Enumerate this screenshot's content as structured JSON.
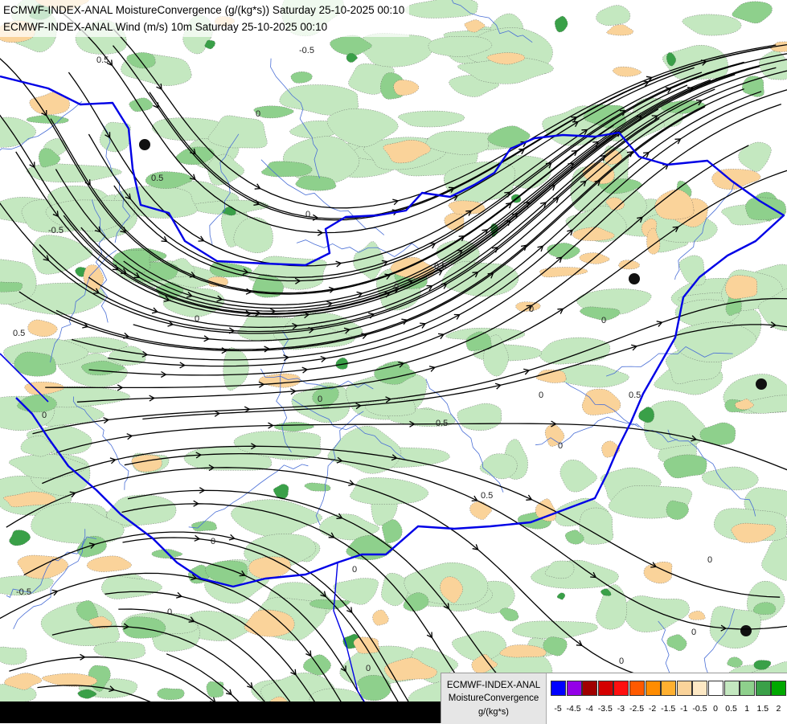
{
  "header": {
    "line1": "ECMWF-INDEX-ANAL MoistureConvergence (g/(kg*s)) Saturday 25-10-2025 00:10",
    "line2": "ECMWF-INDEX-ANAL Wind (m/s) 10m Saturday 25-10-2025 00:10"
  },
  "map": {
    "contour_labels": [
      "0.5",
      "-0.5",
      "0",
      "0.5",
      "0",
      "-0.5",
      "0.5",
      "0",
      "0",
      "0.5",
      "0",
      "0",
      "0.5",
      "0",
      "0",
      "0.5",
      "0",
      "0",
      "-0.5",
      "0",
      "0",
      "0",
      "0",
      "0",
      "0.5",
      "0",
      "0"
    ],
    "colors": {
      "background": "#ffffff",
      "light_green": "#c4e8c0",
      "mid_green": "#8ed08c",
      "dark_green": "#3aa048",
      "orange_light": "#fad39a",
      "orange_mid": "#f5b86a",
      "border": "#0000e6",
      "rivers": "#4a6fd6",
      "streamlines": "#000000"
    }
  },
  "legend": {
    "model": "ECMWF-INDEX-ANAL",
    "parameter": "MoistureConvergence",
    "unit": "g/(kg*s)",
    "tick_labels": [
      "-5",
      "-4.5",
      "-4",
      "-3.5",
      "-3",
      "-2.5",
      "-2",
      "-1.5",
      "-1",
      "-0.5",
      "0",
      "0.5",
      "1",
      "1.5",
      "2"
    ],
    "swatch_colors": [
      "#0000ff",
      "#9400e8",
      "#a00000",
      "#d40000",
      "#ff1010",
      "#ff5a00",
      "#ff8c00",
      "#ffb030",
      "#fad39a",
      "#fde8c4",
      "#ffffff",
      "#c4e8c0",
      "#8ed08c",
      "#3aa048",
      "#00a800"
    ]
  }
}
